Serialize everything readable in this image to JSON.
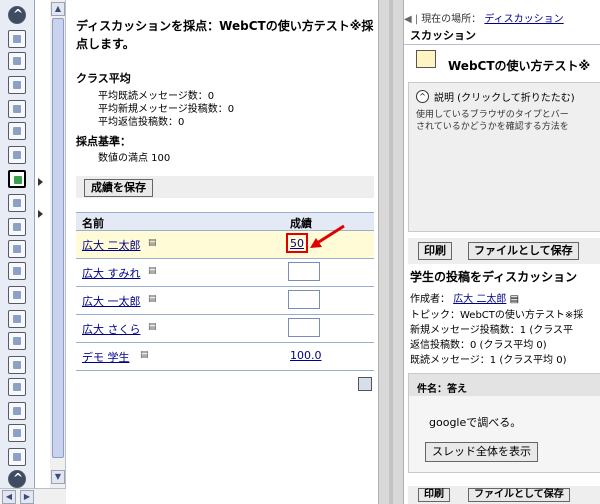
{
  "toolbar": {
    "icons": [
      "collapse-up-icon",
      "home-icon",
      "tools-icon",
      "notes-icon",
      "edit-icon",
      "calendar-icon",
      "chat-icon",
      "discussion-grade-icon",
      "apple-icon",
      "document-icon",
      "course-icon",
      "compass-icon",
      "mail-icon",
      "notebook-icon",
      "users-icon",
      "calendar-icon",
      "search-icon",
      "copy-icon",
      "globe-icon",
      "glossary-icon",
      "collapse-up-icon",
      "bell-icon"
    ]
  },
  "main": {
    "title": "ディスカッションを採点：WebCTの使い方テスト※採点します。",
    "class_average": {
      "title": "クラス平均",
      "lines": [
        "平均既読メッセージ数：0",
        "平均新規メッセージ投稿数：0",
        "平均返信投稿数：0"
      ]
    },
    "criteria": {
      "title": "採点基準：",
      "value": "数値の満点 100"
    },
    "save_button": "成績を保存",
    "table": {
      "headers": {
        "name": "名前",
        "grade": "成績"
      },
      "rows": [
        {
          "student": "広大 二太郎",
          "grade": "50",
          "type": "link"
        },
        {
          "student": "広大 すみれ",
          "grade": "",
          "type": "input"
        },
        {
          "student": "広大 一太郎",
          "grade": "",
          "type": "input"
        },
        {
          "student": "広大 さくら",
          "grade": "",
          "type": "input"
        },
        {
          "student": "デモ 学生",
          "grade": "100.0",
          "type": "link"
        }
      ]
    }
  },
  "right": {
    "breadcrumb": {
      "prefix": "現在の場所：",
      "link": "ディスカッション"
    },
    "breadcrumb_tail": "スカッション",
    "topic_title": "WebCTの使い方テスト※",
    "description_toggle": "説明 (クリックして折りたたむ)",
    "description_lines": [
      "使用しているブラウザのタイプとバー",
      "されているかどうかを確認する方法を"
    ],
    "print_button": "印刷",
    "save_file_button": "ファイルとして保存",
    "posts_title": "学生の投稿をディスカッション",
    "author_label": "作成者：",
    "author": "広大 二太郎",
    "topic_line": "トピック：WebCTの使い方テスト※採",
    "new_posts_line": "新規メッセージ投稿数：1 (クラス平",
    "reply_line": "返信投稿数：0 (クラス平均 0)",
    "read_line": "既読メッセージ：1 (クラス平均 0)",
    "subject_label": "件名：答え",
    "post_body": "googleで調べる。",
    "thread_button": "スレッド全体を表示",
    "bottom_print": "印刷",
    "bottom_save": "ファイルとして保存"
  }
}
